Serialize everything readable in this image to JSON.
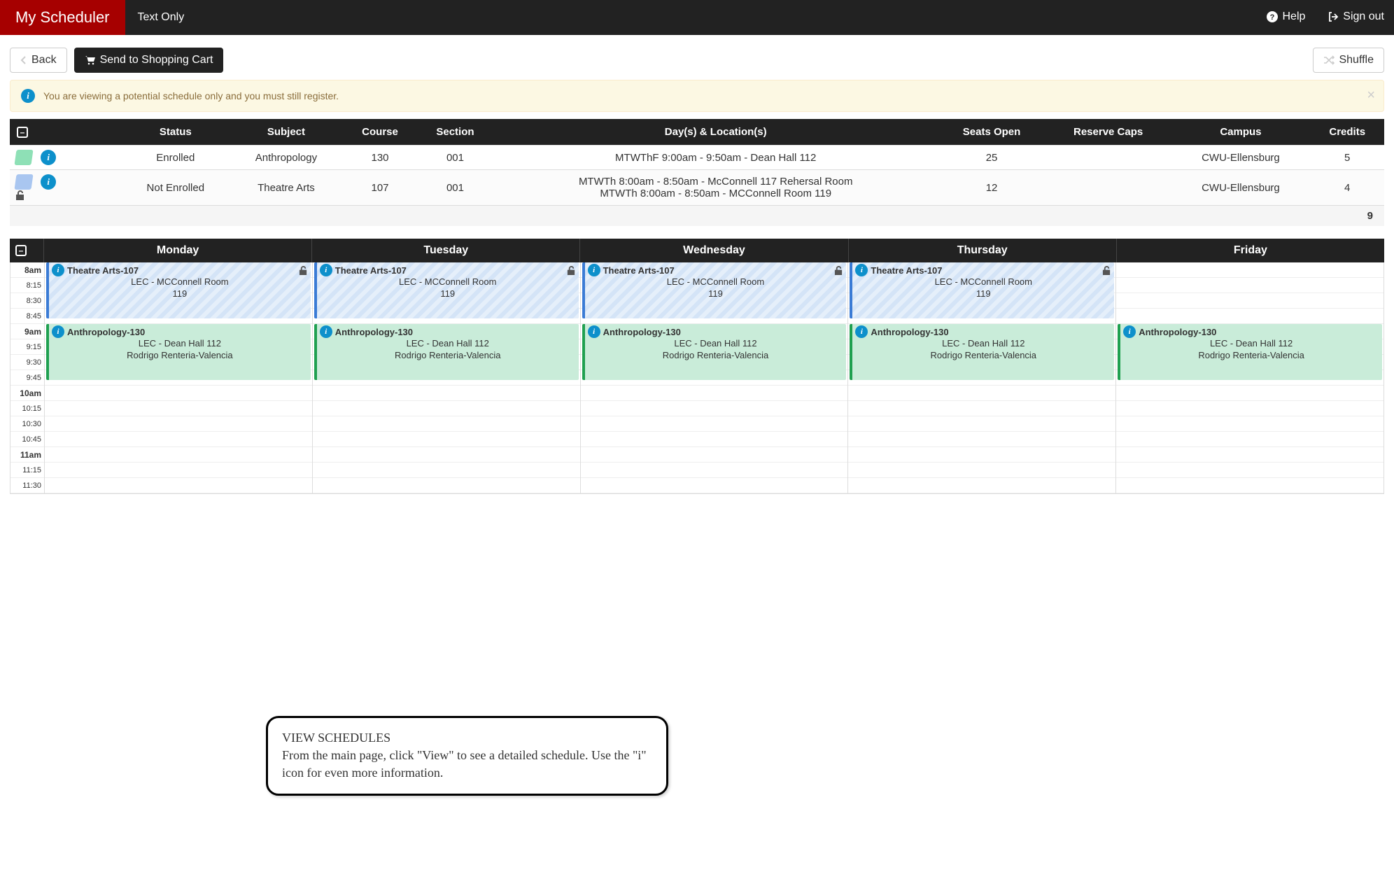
{
  "navbar": {
    "brand": "My Scheduler",
    "text_only": "Text Only",
    "help": "Help",
    "sign_out": "Sign out"
  },
  "toolbar": {
    "back": "Back",
    "cart": "Send to Shopping Cart",
    "shuffle": "Shuffle"
  },
  "alert": {
    "message": "You are viewing a potential schedule only and you must still register."
  },
  "table": {
    "headers": {
      "status": "Status",
      "subject": "Subject",
      "course": "Course",
      "section": "Section",
      "days": "Day(s) & Location(s)",
      "seats": "Seats Open",
      "reserve": "Reserve Caps",
      "campus": "Campus",
      "credits": "Credits"
    },
    "rows": [
      {
        "swatch": "green",
        "lock": false,
        "status": "Enrolled",
        "subject": "Anthropology",
        "course": "130",
        "section": "001",
        "days": "MTWThF 9:00am - 9:50am - Dean Hall 112",
        "seats": "25",
        "reserve": "",
        "campus": "CWU-Ellensburg",
        "credits": "5"
      },
      {
        "swatch": "blue",
        "lock": true,
        "status": "Not Enrolled",
        "subject": "Theatre Arts",
        "course": "107",
        "section": "001",
        "days": "MTWTh 8:00am - 8:50am - McConnell 117 Rehersal Room\nMTWTh 8:00am - 8:50am - MCConnell Room 119",
        "seats": "12",
        "reserve": "",
        "campus": "CWU-Ellensburg",
        "credits": "4"
      }
    ],
    "total_credits": "9"
  },
  "calendar": {
    "days": [
      "Monday",
      "Tuesday",
      "Wednesday",
      "Thursday",
      "Friday"
    ],
    "time_labels": [
      "8am",
      "8:15",
      "8:30",
      "8:45",
      "9am",
      "9:15",
      "9:30",
      "9:45",
      "10am",
      "10:15",
      "10:30",
      "10:45",
      "11am",
      "11:15",
      "11:30"
    ],
    "events": {
      "theatre": {
        "title": "Theatre Arts-107",
        "line1": "LEC - MCConnell Room",
        "line2": "119",
        "days": [
          "Monday",
          "Tuesday",
          "Wednesday",
          "Thursday"
        ]
      },
      "anthro": {
        "title": "Anthropology-130",
        "line1": "LEC - Dean Hall 112",
        "line2": "Rodrigo Renteria-Valencia",
        "days": [
          "Monday",
          "Tuesday",
          "Wednesday",
          "Thursday",
          "Friday"
        ]
      }
    }
  },
  "callout": {
    "title": "VIEW SCHEDULES",
    "body": "From the main page, click \"View\" to see a detailed schedule. Use the \"i\" icon for even more information."
  }
}
